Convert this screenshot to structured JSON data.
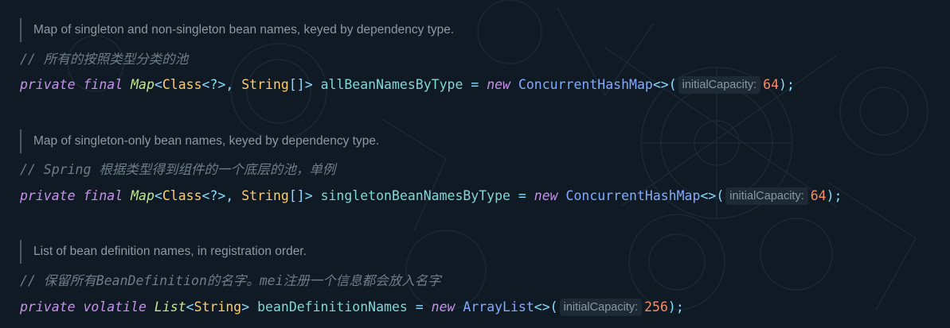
{
  "colors": {
    "background": "#0f1a24",
    "keyword": "#c792ea",
    "type_generic": "#c3e88d",
    "class_name": "#ffcb6b",
    "identifier": "#82d6d6",
    "constructor": "#82aaff",
    "number": "#f78c6c",
    "comment": "#6f7c89",
    "doc_text": "#9098a2"
  },
  "blocks": [
    {
      "doc": "Map of singleton and non-singleton bean names, keyed by dependency type.",
      "comment": "// 所有的按照类型分类的池",
      "code": {
        "mod1": "private",
        "mod2": "final",
        "type": "Map",
        "lt": "<",
        "arg1": "Class",
        "wild": "<?>",
        "comma": ",",
        "arg2": "String",
        "arr": "[]",
        "gt": ">",
        "name": "allBeanNamesByType",
        "eq": "=",
        "new": "new",
        "ctor": "ConcurrentHashMap",
        "diamond": "<>",
        "open": "(",
        "hint": "initialCapacity:",
        "value": "64",
        "close": ");"
      }
    },
    {
      "doc": "Map of singleton-only bean names, keyed by dependency type.",
      "comment": "// Spring 根据类型得到组件的一个底层的池，单例",
      "code": {
        "mod1": "private",
        "mod2": "final",
        "type": "Map",
        "lt": "<",
        "arg1": "Class",
        "wild": "<?>",
        "comma": ",",
        "arg2": "String",
        "arr": "[]",
        "gt": ">",
        "name": "singletonBeanNamesByType",
        "eq": "=",
        "new": "new",
        "ctor": "ConcurrentHashMap",
        "diamond": "<>",
        "open": "(",
        "hint": "initialCapacity:",
        "value": "64",
        "close": ");"
      }
    },
    {
      "doc": "List of bean definition names, in registration order.",
      "comment": "// 保留所有BeanDefinition的名字。mei注册一个信息都会放入名字",
      "code": {
        "mod1": "private",
        "mod2": "volatile",
        "type": "List",
        "lt": "<",
        "arg1": "String",
        "gt": ">",
        "name": "beanDefinitionNames",
        "eq": "=",
        "new": "new",
        "ctor": "ArrayList",
        "diamond": "<>",
        "open": "(",
        "hint": "initialCapacity:",
        "value": "256",
        "close": ");"
      }
    }
  ]
}
